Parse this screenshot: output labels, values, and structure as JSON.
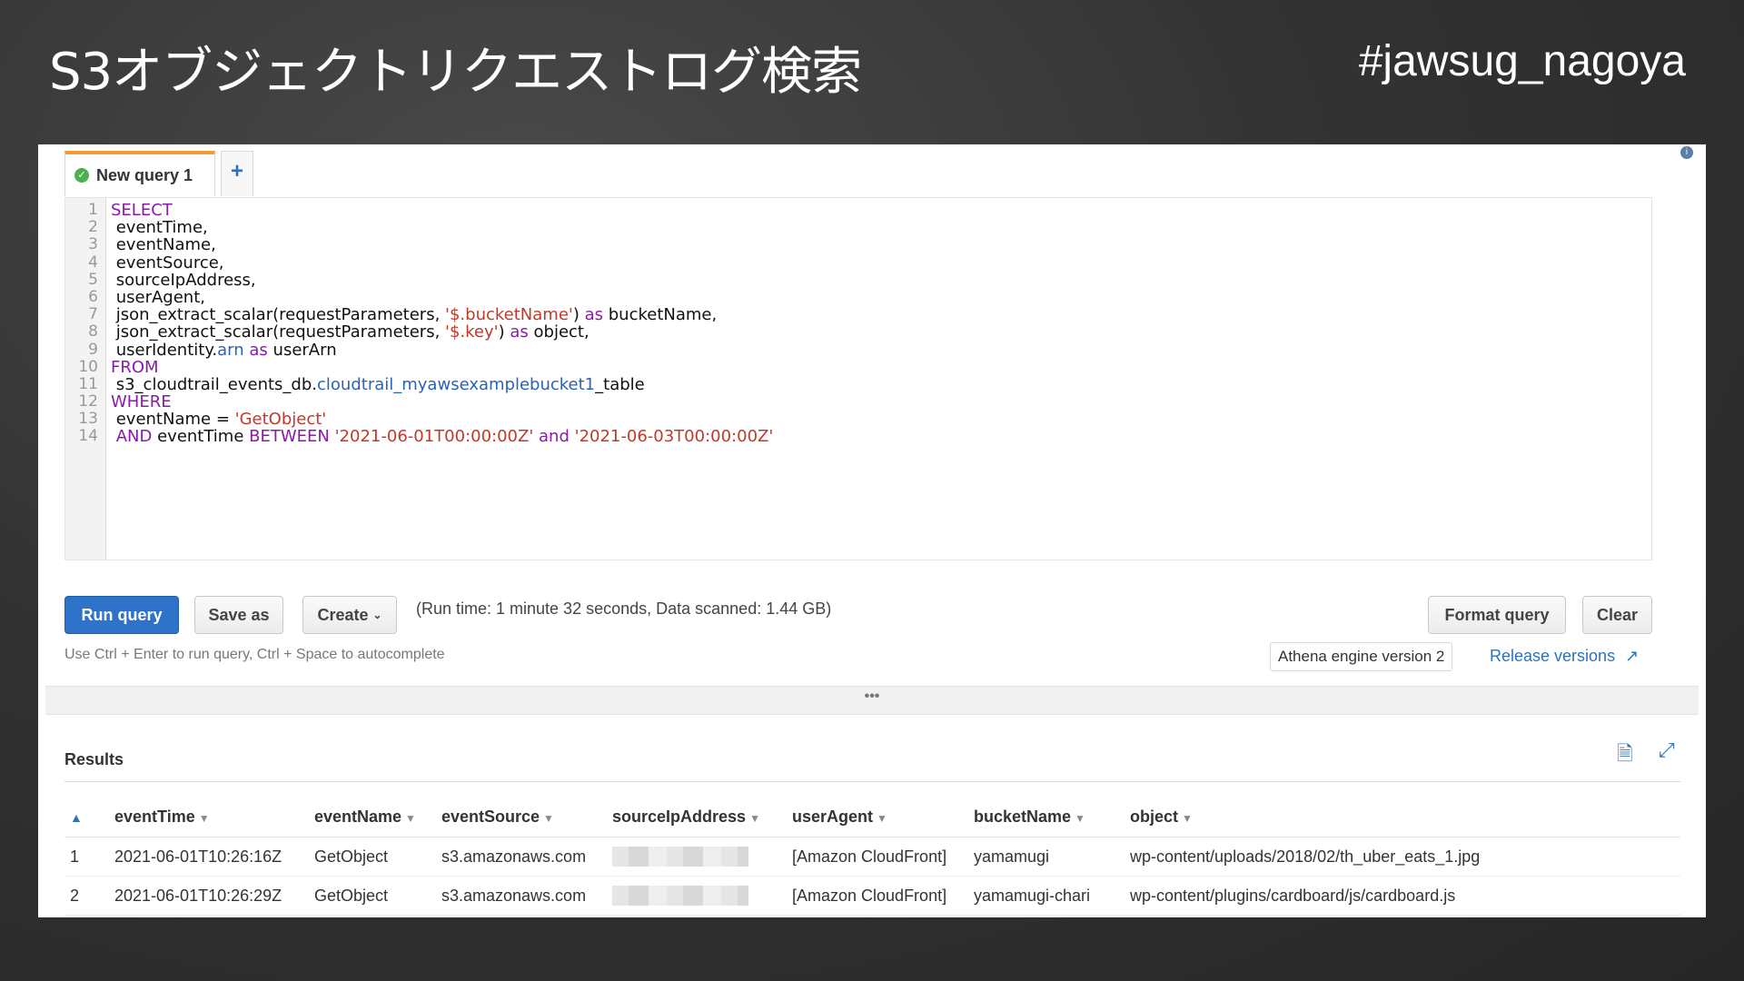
{
  "slide": {
    "title": "S3オブジェクトリクエストログ検索",
    "hashtag": "#jawsug_nagoya"
  },
  "tabs": [
    {
      "label": "New query 1",
      "status_icon": "check-circle-icon",
      "active": true
    }
  ],
  "add_tab_label": "+",
  "editor": {
    "lines": [
      {
        "n": "1",
        "parts": [
          {
            "t": "kw",
            "v": "SELECT"
          }
        ]
      },
      {
        "n": "2",
        "parts": [
          {
            "t": "plain",
            "v": " eventTime,"
          }
        ]
      },
      {
        "n": "3",
        "parts": [
          {
            "t": "plain",
            "v": " eventName,"
          }
        ]
      },
      {
        "n": "4",
        "parts": [
          {
            "t": "plain",
            "v": " eventSource,"
          }
        ]
      },
      {
        "n": "5",
        "parts": [
          {
            "t": "plain",
            "v": " sourceIpAddress,"
          }
        ]
      },
      {
        "n": "6",
        "parts": [
          {
            "t": "plain",
            "v": " userAgent,"
          }
        ]
      },
      {
        "n": "7",
        "parts": [
          {
            "t": "plain",
            "v": " json_extract_scalar(requestParameters, "
          },
          {
            "t": "str",
            "v": "'$.bucketName'"
          },
          {
            "t": "plain",
            "v": ") "
          },
          {
            "t": "kw",
            "v": "as"
          },
          {
            "t": "plain",
            "v": " bucketName,"
          }
        ]
      },
      {
        "n": "8",
        "parts": [
          {
            "t": "plain",
            "v": " json_extract_scalar(requestParameters, "
          },
          {
            "t": "str",
            "v": "'$.key'"
          },
          {
            "t": "plain",
            "v": ") "
          },
          {
            "t": "kw",
            "v": "as"
          },
          {
            "t": "plain",
            "v": " object,"
          }
        ]
      },
      {
        "n": "9",
        "parts": [
          {
            "t": "plain",
            "v": " userIdentity."
          },
          {
            "t": "ident",
            "v": "arn"
          },
          {
            "t": "plain",
            "v": " "
          },
          {
            "t": "kw",
            "v": "as"
          },
          {
            "t": "plain",
            "v": " userArn"
          }
        ]
      },
      {
        "n": "10",
        "parts": [
          {
            "t": "kw",
            "v": "FROM"
          }
        ]
      },
      {
        "n": "11",
        "parts": [
          {
            "t": "plain",
            "v": " s3_cloudtrail_events_db."
          },
          {
            "t": "ident",
            "v": "cloudtrail_myawsexamplebucket1"
          },
          {
            "t": "plain",
            "v": "_table"
          }
        ]
      },
      {
        "n": "12",
        "parts": [
          {
            "t": "kw",
            "v": "WHERE"
          }
        ]
      },
      {
        "n": "13",
        "parts": [
          {
            "t": "plain",
            "v": " eventName = "
          },
          {
            "t": "str",
            "v": "'GetObject'"
          }
        ]
      },
      {
        "n": "14",
        "parts": [
          {
            "t": "plain",
            "v": " "
          },
          {
            "t": "kw",
            "v": "AND"
          },
          {
            "t": "plain",
            "v": " eventTime "
          },
          {
            "t": "kw",
            "v": "BETWEEN"
          },
          {
            "t": "plain",
            "v": " "
          },
          {
            "t": "str",
            "v": "'2021-06-01T00:00:00Z'"
          },
          {
            "t": "plain",
            "v": " "
          },
          {
            "t": "kw",
            "v": "and"
          },
          {
            "t": "plain",
            "v": " "
          },
          {
            "t": "str",
            "v": "'2021-06-03T00:00:00Z'"
          }
        ]
      }
    ]
  },
  "toolbar": {
    "run_label": "Run query",
    "save_label": "Save as",
    "create_label": "Create",
    "run_info": "(Run time: 1 minute 32 seconds, Data scanned: 1.44 GB)",
    "format_label": "Format query",
    "clear_label": "Clear",
    "hint": "Use Ctrl + Enter to run query, Ctrl + Space to autocomplete",
    "engine": "Athena engine version 2",
    "release_label": "Release versions"
  },
  "divider_label": "•••",
  "results": {
    "title": "Results",
    "columns": [
      "eventTime",
      "eventName",
      "eventSource",
      "sourceIpAddress",
      "userAgent",
      "bucketName",
      "object"
    ],
    "rows": [
      {
        "n": "1",
        "cells": [
          "2021-06-01T10:26:16Z",
          "GetObject",
          "s3.amazonaws.com",
          "",
          "[Amazon CloudFront]",
          "yamamugi",
          "wp-content/uploads/2018/02/th_uber_eats_1.jpg"
        ]
      },
      {
        "n": "2",
        "cells": [
          "2021-06-01T10:26:29Z",
          "GetObject",
          "s3.amazonaws.com",
          "",
          "[Amazon CloudFront]",
          "yamamugi-chari",
          "wp-content/plugins/cardboard/js/cardboard.js"
        ]
      }
    ]
  },
  "colors": {
    "primary": "#2e73c9",
    "keyword": "#8a1aa8",
    "string": "#c0392b",
    "tab_accent": "#f39c34"
  }
}
